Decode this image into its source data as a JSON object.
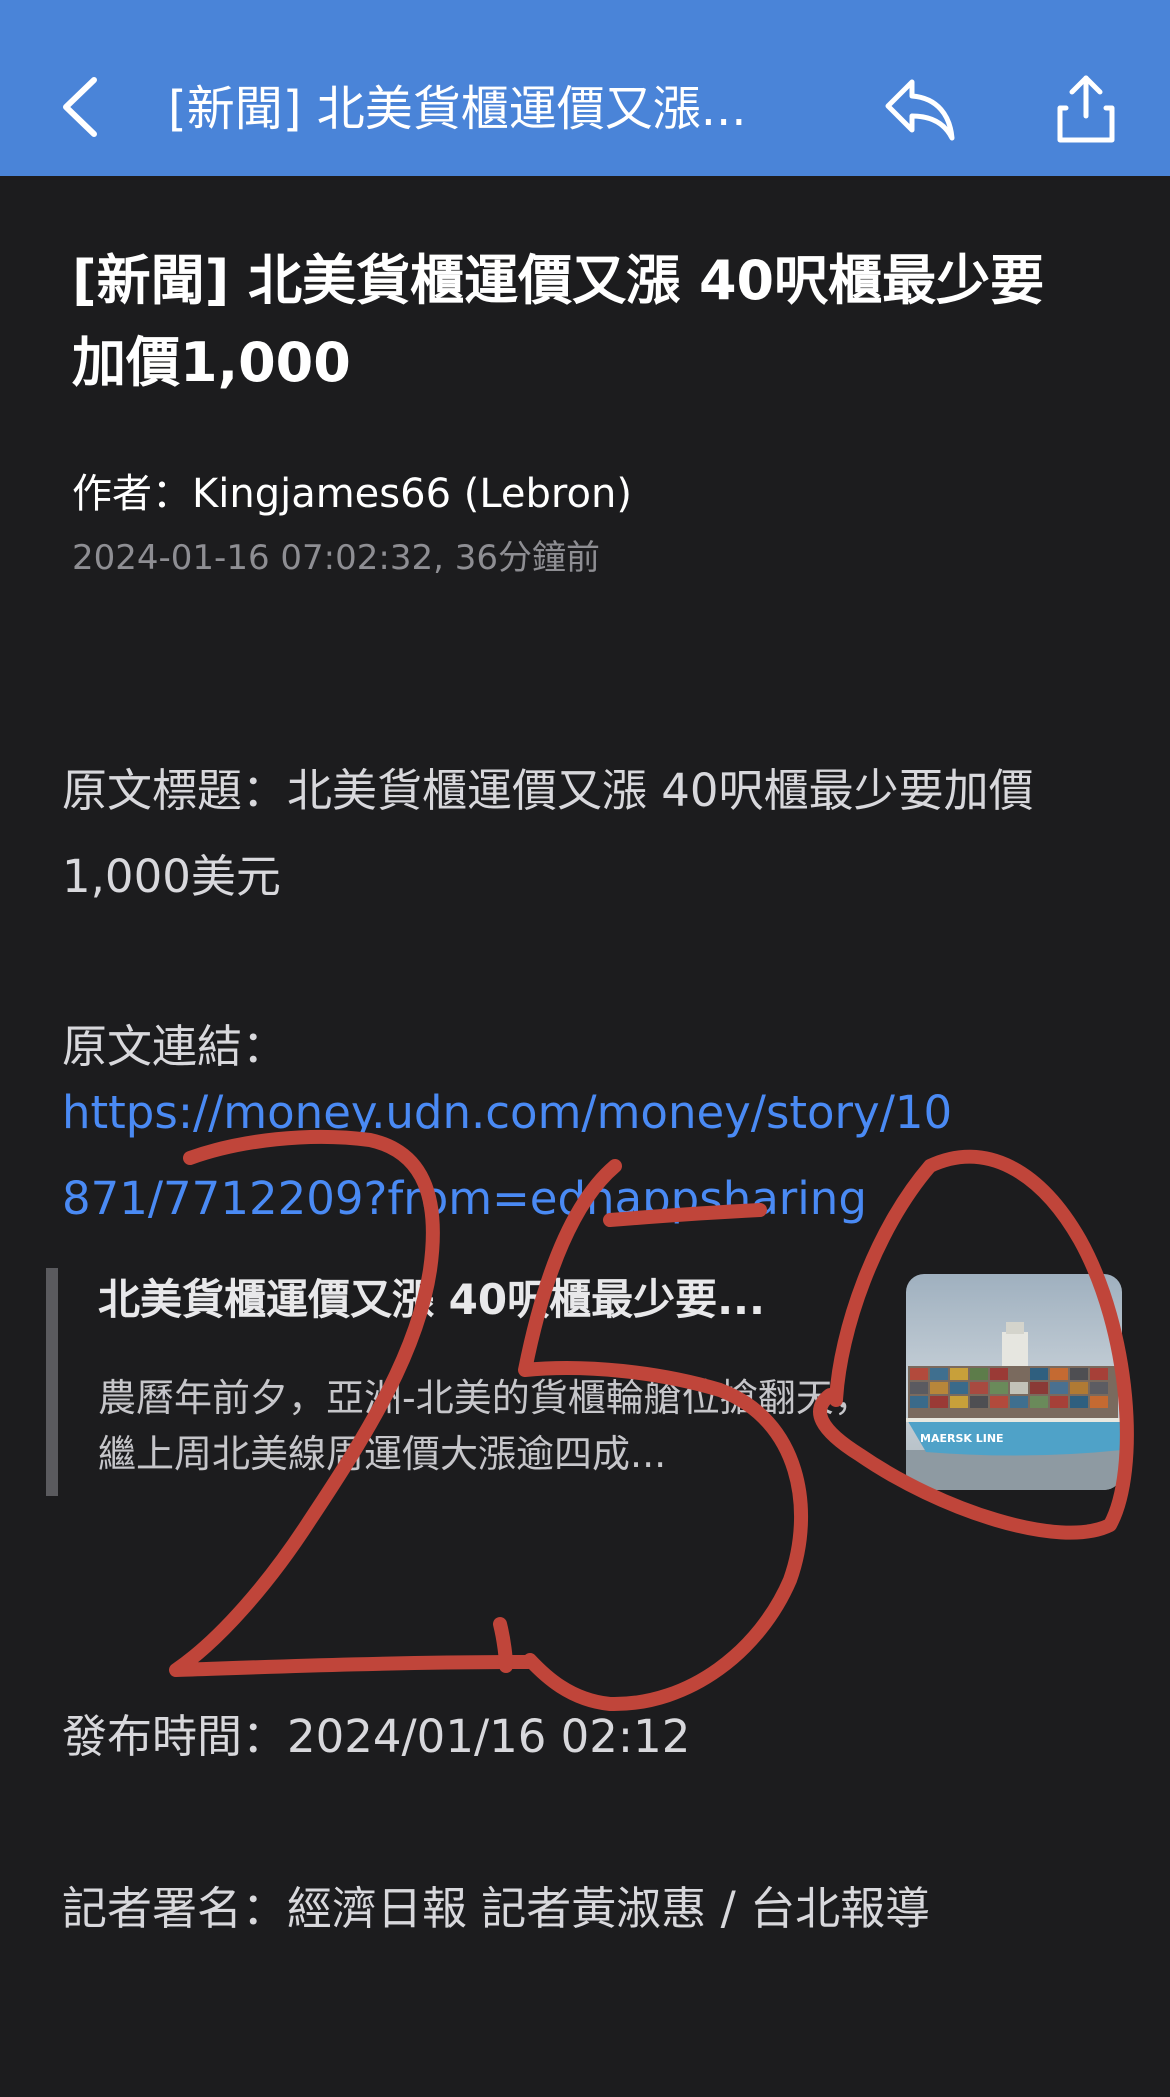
{
  "navbar": {
    "title": "[新聞] 北美貨櫃運價又漲...",
    "back_icon": "chevron-left-icon",
    "reply_icon": "reply-arrow-icon",
    "share_icon": "share-icon",
    "background": "#4a84d8"
  },
  "article": {
    "title": "[新聞] 北美貨櫃運價又漲 40呎櫃最少要加價1,000",
    "author": "作者：Kingjames66 (Lebron)",
    "timestamp": "2024-01-16 07:02:32, 36分鐘前"
  },
  "body": {
    "original_title": "原文標題：北美貨櫃運價又漲 40呎櫃最少要加價1,000美元",
    "link_label": "原文連結：",
    "link_url": "https://money.udn.com/money/story/10871/7712209?from=ednappsharing",
    "publish_time": "發布時間：2024/01/16 02:12",
    "reporter": "記者署名：經濟日報 記者黃淑惠 / 台北報導"
  },
  "preview": {
    "title": "北美貨櫃運價又漲 40呎櫃最少要...",
    "description": "農曆年前夕，亞洲-北美的貨櫃輪艙位搶翻天，繼上周北美線周運價大漲逾四成...",
    "thumbnail": "container-ship-image",
    "ship_text": "MAERSK LINE"
  },
  "overlay": {
    "handwriting": "250",
    "color": "#c0453a"
  }
}
